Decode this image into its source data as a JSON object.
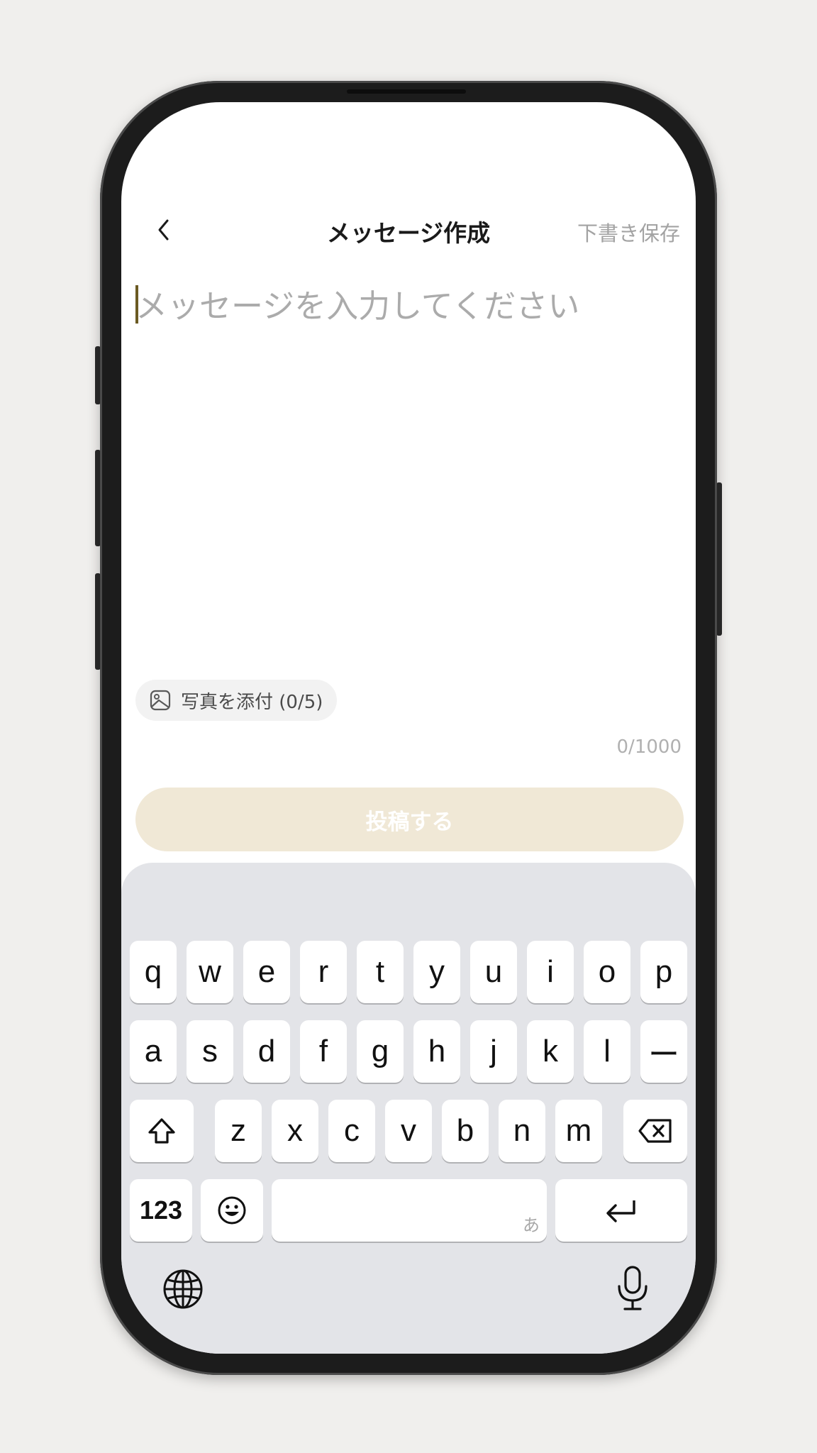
{
  "header": {
    "back_icon": "chevron-left-icon",
    "title": "メッセージ作成",
    "draft_label": "下書き保存"
  },
  "editor": {
    "placeholder": "メッセージを入力してください",
    "value": "",
    "counter": "0/1000"
  },
  "attach": {
    "icon": "image-icon",
    "label": "写真を添付 (0/5)"
  },
  "post": {
    "label": "投稿する",
    "color": "#f0e8d6",
    "enabled": false
  },
  "keyboard": {
    "row1": [
      "q",
      "w",
      "e",
      "r",
      "t",
      "y",
      "u",
      "i",
      "o",
      "p"
    ],
    "row2": [
      "a",
      "s",
      "d",
      "f",
      "g",
      "h",
      "j",
      "k",
      "l",
      "ー"
    ],
    "row3": [
      "z",
      "x",
      "c",
      "v",
      "b",
      "n",
      "m"
    ],
    "numbers_label": "123",
    "space_hint": "あ",
    "icons": {
      "shift": "shift-icon",
      "delete": "backspace-icon",
      "emoji": "emoji-icon",
      "return": "return-icon",
      "globe": "globe-icon",
      "mic": "microphone-icon"
    }
  },
  "colors": {
    "accent_caret": "#6b5a22",
    "keyboard_bg": "#e3e4e8"
  }
}
